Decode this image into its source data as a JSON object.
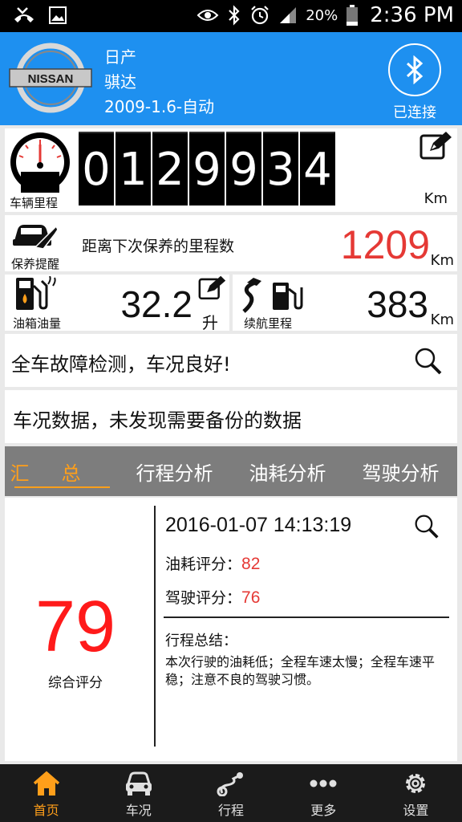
{
  "status_bar": {
    "battery_pct": "20%",
    "time": "2:36 PM",
    "icons": [
      "missed-call-icon",
      "image-icon",
      "eye-icon",
      "bluetooth-icon",
      "alarm-icon",
      "signal-icon",
      "battery-icon"
    ]
  },
  "header": {
    "brand_logo": "NISSAN",
    "make": "日产",
    "model": "骐达",
    "variant": "2009-1.6-自动",
    "bluetooth_status": "已连接"
  },
  "odometer": {
    "label": "车辆里程",
    "digits": [
      "0",
      "1",
      "2",
      "9",
      "9",
      "3",
      "4"
    ],
    "unit": "Km"
  },
  "maintenance": {
    "label": "保养提醒",
    "text": "距离下次保养的里程数",
    "value": "1209",
    "unit": "Km"
  },
  "fuel": {
    "label": "油箱油量",
    "value": "32.2",
    "unit": "升"
  },
  "range": {
    "label": "续航里程",
    "value": "383",
    "unit": "Km"
  },
  "diagnostics": {
    "text": "全车故障检测，车况良好!"
  },
  "backup": {
    "text": "车况数据，未发现需要备份的数据"
  },
  "tabs": [
    {
      "label": "汇总",
      "active": true
    },
    {
      "label": "行程分析",
      "active": false
    },
    {
      "label": "油耗分析",
      "active": false
    },
    {
      "label": "驾驶分析",
      "active": false
    }
  ],
  "summary": {
    "overall_score": "79",
    "overall_label": "综合评分",
    "datetime": "2016-01-07 14:13:19",
    "fuel_score_label": "油耗评分：",
    "fuel_score": "82",
    "driving_score_label": "驾驶评分：",
    "driving_score": "76",
    "trip_summary_title": "行程总结：",
    "trip_summary_text": "本次行驶的油耗低；全程车速太慢；全程车速平稳；注意不良的驾驶习惯。"
  },
  "bottom_nav": [
    {
      "label": "首页",
      "icon": "home-icon",
      "active": true
    },
    {
      "label": "车况",
      "icon": "car-icon",
      "active": false
    },
    {
      "label": "行程",
      "icon": "route-icon",
      "active": false
    },
    {
      "label": "更多",
      "icon": "more-icon",
      "active": false
    },
    {
      "label": "设置",
      "icon": "gear-icon",
      "active": false
    }
  ],
  "colors": {
    "header_blue": "#1e90f0",
    "accent_orange": "#ff9f1a",
    "alert_red": "#e53935",
    "tab_gray": "#7d7d7d",
    "nav_dark": "#1b1b1b"
  }
}
